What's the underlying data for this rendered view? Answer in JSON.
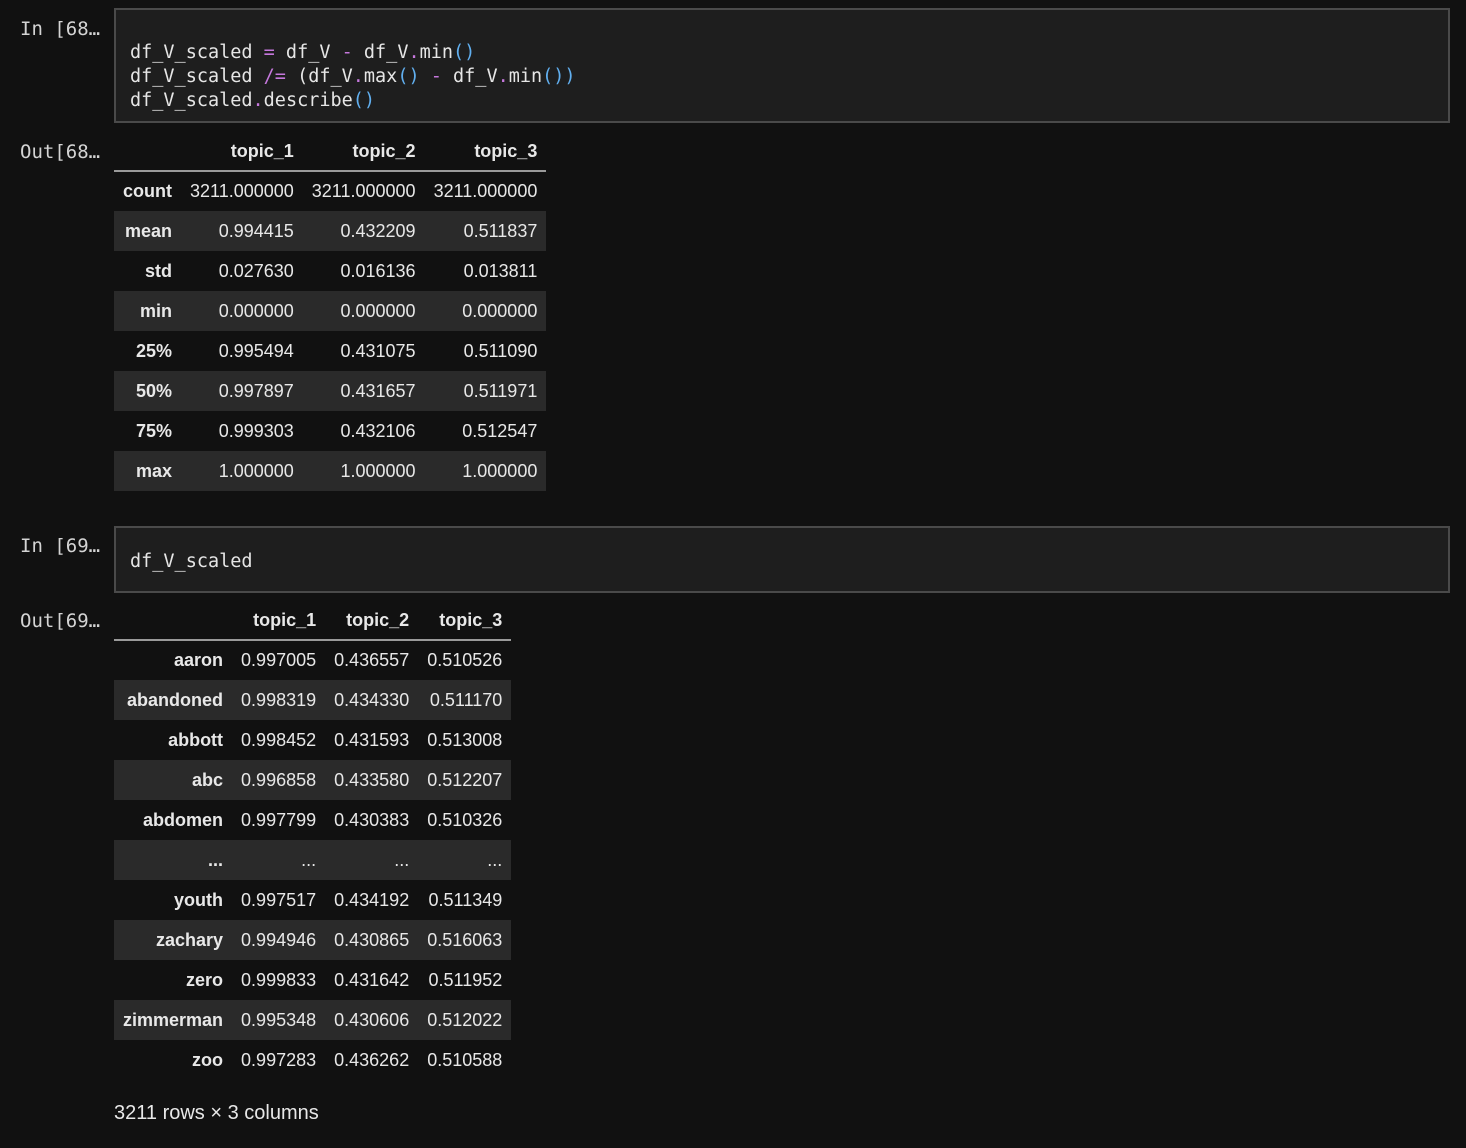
{
  "cells": [
    {
      "in_prompt": "In [68…",
      "out_prompt": "Out[68…",
      "code_lines": [
        [
          {
            "t": "df_V_scaled "
          },
          {
            "t": "=",
            "c": "op"
          },
          {
            "t": " df_V "
          },
          {
            "t": "-",
            "c": "op"
          },
          {
            "t": " df_V"
          },
          {
            "t": ".",
            "c": "op"
          },
          {
            "t": "min"
          },
          {
            "t": "()",
            "c": "paren"
          }
        ],
        [
          {
            "t": "df_V_scaled "
          },
          {
            "t": "/=",
            "c": "op"
          },
          {
            "t": " (df_V"
          },
          {
            "t": ".",
            "c": "op"
          },
          {
            "t": "max"
          },
          {
            "t": "()",
            "c": "paren"
          },
          {
            "t": " "
          },
          {
            "t": "-",
            "c": "op"
          },
          {
            "t": " df_V"
          },
          {
            "t": ".",
            "c": "op"
          },
          {
            "t": "min"
          },
          {
            "t": "())",
            "c": "paren"
          }
        ],
        [
          {
            "t": "df_V_scaled"
          },
          {
            "t": ".",
            "c": "op"
          },
          {
            "t": "describe"
          },
          {
            "t": "()",
            "c": "paren"
          }
        ]
      ],
      "table": {
        "columns": [
          "",
          "topic_1",
          "topic_2",
          "topic_3"
        ],
        "rows": [
          [
            "count",
            "3211.000000",
            "3211.000000",
            "3211.000000"
          ],
          [
            "mean",
            "0.994415",
            "0.432209",
            "0.511837"
          ],
          [
            "std",
            "0.027630",
            "0.016136",
            "0.013811"
          ],
          [
            "min",
            "0.000000",
            "0.000000",
            "0.000000"
          ],
          [
            "25%",
            "0.995494",
            "0.431075",
            "0.511090"
          ],
          [
            "50%",
            "0.997897",
            "0.431657",
            "0.511971"
          ],
          [
            "75%",
            "0.999303",
            "0.432106",
            "0.512547"
          ],
          [
            "max",
            "1.000000",
            "1.000000",
            "1.000000"
          ]
        ]
      }
    },
    {
      "in_prompt": "In [69…",
      "out_prompt": "Out[69…",
      "code_lines": [
        [
          {
            "t": "df_V_scaled"
          }
        ]
      ],
      "table": {
        "columns": [
          "",
          "topic_1",
          "topic_2",
          "topic_3"
        ],
        "rows": [
          [
            "aaron",
            "0.997005",
            "0.436557",
            "0.510526"
          ],
          [
            "abandoned",
            "0.998319",
            "0.434330",
            "0.511170"
          ],
          [
            "abbott",
            "0.998452",
            "0.431593",
            "0.513008"
          ],
          [
            "abc",
            "0.996858",
            "0.433580",
            "0.512207"
          ],
          [
            "abdomen",
            "0.997799",
            "0.430383",
            "0.510326"
          ],
          [
            "...",
            "...",
            "...",
            "..."
          ],
          [
            "youth",
            "0.997517",
            "0.434192",
            "0.511349"
          ],
          [
            "zachary",
            "0.994946",
            "0.430865",
            "0.516063"
          ],
          [
            "zero",
            "0.999833",
            "0.431642",
            "0.511952"
          ],
          [
            "zimmerman",
            "0.995348",
            "0.430606",
            "0.512022"
          ],
          [
            "zoo",
            "0.997283",
            "0.436262",
            "0.510588"
          ]
        ]
      },
      "shape_note": "3211 rows × 3 columns"
    }
  ]
}
